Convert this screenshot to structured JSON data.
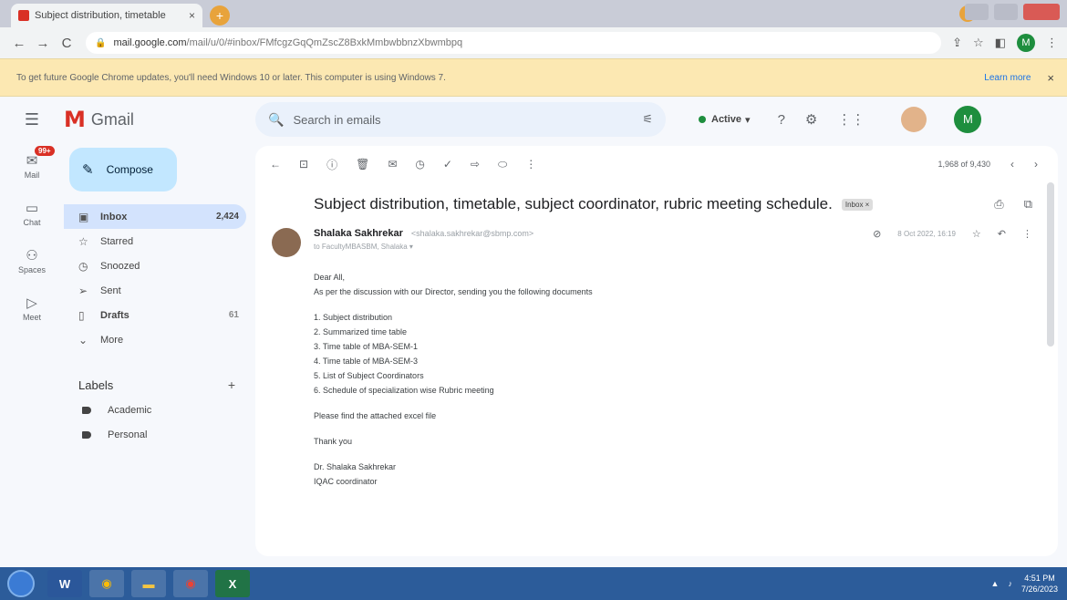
{
  "browser": {
    "tab_title": "Subject distribution, timetable",
    "tab_close": "×",
    "new_tab": "+",
    "url_host": "mail.google.com",
    "url_path": "/mail/u/0/#inbox/FMfcgzGqQmZscZ8BxkMmbwbbnzXbwmbpq",
    "nav_back": "←",
    "nav_forward": "→",
    "nav_reload": "C",
    "profile_initial": "M"
  },
  "infobar": {
    "message": "To get future Google Chrome updates, you'll need Windows 10 or later. This computer is using Windows 7.",
    "learn_more": "Learn more",
    "close": "×"
  },
  "gmail_header": {
    "brand": "Gmail",
    "search_placeholder": "Search in emails",
    "status": "Active",
    "avatar_initial": "M"
  },
  "rail": {
    "items": [
      {
        "label": "Mail",
        "icon": "mail-icon",
        "badge": "99+"
      },
      {
        "label": "Chat",
        "icon": "chat-icon"
      },
      {
        "label": "Spaces",
        "icon": "spaces-icon"
      },
      {
        "label": "Meet",
        "icon": "meet-icon"
      }
    ]
  },
  "sidebar": {
    "compose": "Compose",
    "items": [
      {
        "label": "Inbox",
        "count": "2,424",
        "icon": "inbox-icon"
      },
      {
        "label": "Starred",
        "count": "",
        "icon": "star-icon"
      },
      {
        "label": "Snoozed",
        "count": "",
        "icon": "clock-icon"
      },
      {
        "label": "Sent",
        "count": "",
        "icon": "send-icon"
      },
      {
        "label": "Drafts",
        "count": "61",
        "icon": "draft-icon"
      },
      {
        "label": "More",
        "count": "",
        "icon": "chevron-down-icon"
      }
    ],
    "labels_heading": "Labels",
    "labels": [
      "Academic",
      "Personal"
    ]
  },
  "message": {
    "pagination": "1,968 of 9,430",
    "subject": "Subject distribution, timetable, subject coordinator, rubric meeting schedule.",
    "inbox_chip": "Inbox ×",
    "sender_name": "Shalaka Sakhrekar",
    "sender_email": "<shalaka.sakhrekar@sbmp.com>",
    "to_line": "to FacultyMBASBM, Shalaka ▾",
    "date": "8 Oct 2022, 16:19",
    "body": {
      "greeting": "Dear All,",
      "intro": "As per the discussion with our Director, sending you the following documents",
      "list": [
        "1. Subject distribution",
        "2. Summarized time table",
        "3. Time table of MBA-SEM-1",
        "4. Time table of MBA-SEM-3",
        "5. List of Subject Coordinators",
        "6. Schedule of specialization wise Rubric meeting"
      ],
      "attached": "Please find the attached excel file",
      "thanks": "Thank you",
      "signature_name": "Dr. Shalaka Sakhrekar",
      "signature_role": "IQAC coordinator"
    }
  },
  "taskbar": {
    "apps": [
      "W",
      "",
      "",
      "",
      "X"
    ],
    "time": "4:51 PM",
    "date": "7/26/2023"
  },
  "colors": {
    "gmail_red": "#d93025",
    "compose_bg": "#c2e7ff",
    "active_nav": "#d3e3fd",
    "infobar_bg": "#fce8b2",
    "taskbar_bg": "#2c5c9a"
  }
}
